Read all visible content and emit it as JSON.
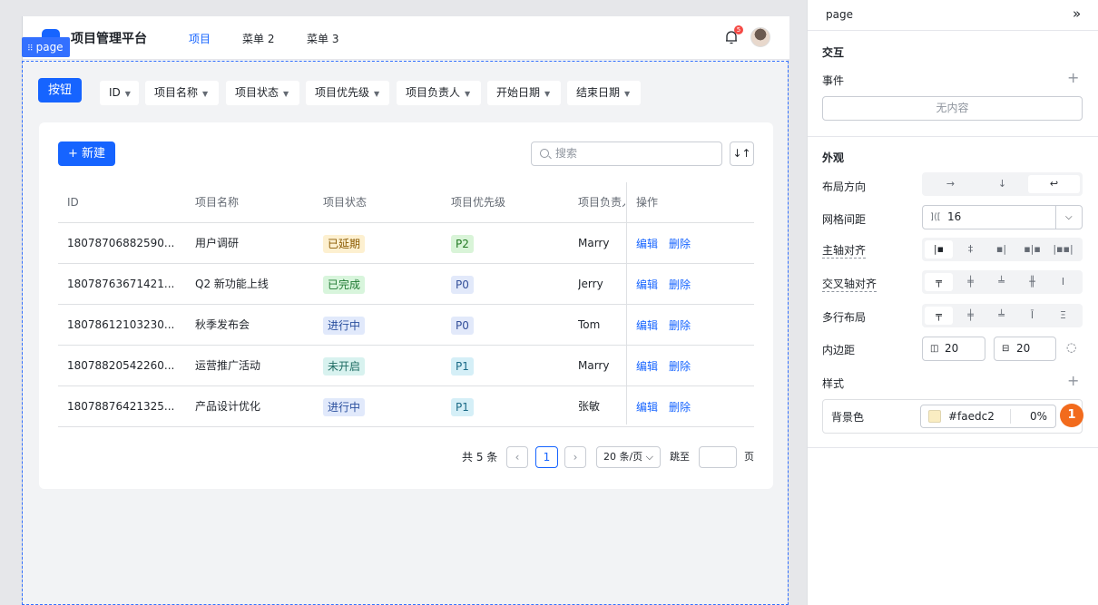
{
  "header": {
    "brand": "项目管理平台",
    "nav": [
      "项目",
      "菜单 2",
      "菜单 3"
    ],
    "bell_badge": "5"
  },
  "page_tag": "page",
  "toolbar": {
    "button_label": "按钮",
    "filters": [
      "ID",
      "项目名称",
      "项目状态",
      "项目优先级",
      "项目负责人",
      "开始日期",
      "结束日期"
    ]
  },
  "card": {
    "new_label": "+ 新建",
    "search_placeholder": "搜索",
    "sort_icon": "↓↑",
    "columns": [
      "ID",
      "项目名称",
      "项目状态",
      "项目优先级",
      "项目负责人",
      "操作"
    ],
    "rows": [
      {
        "id": "18078706882590...",
        "name": "用户调研",
        "status": "已延期",
        "priority": "P2",
        "owner": "Marry"
      },
      {
        "id": "18078763671421...",
        "name": "Q2 新功能上线",
        "status": "已完成",
        "priority": "P0",
        "owner": "Jerry"
      },
      {
        "id": "18078612103230...",
        "name": "秋季发布会",
        "status": "进行中",
        "priority": "P0",
        "owner": "Tom"
      },
      {
        "id": "18078820542260...",
        "name": "运营推广活动",
        "status": "未开启",
        "priority": "P1",
        "owner": "Marry"
      },
      {
        "id": "18078876421325...",
        "name": "产品设计优化",
        "status": "进行中",
        "priority": "P1",
        "owner": "张敏"
      }
    ],
    "actions": {
      "edit": "编辑",
      "delete": "删除"
    },
    "pager": {
      "total": "共 5 条",
      "current": "1",
      "page_size": "20 条/页",
      "jump": "跳至",
      "page_unit": "页"
    }
  },
  "status_colors": {
    "已延期": {
      "bg": "#fdf0d0",
      "fg": "#8a5a00"
    },
    "已完成": {
      "bg": "#d8f5dc",
      "fg": "#1f7a32"
    },
    "进行中": {
      "bg": "#e1e9fb",
      "fg": "#2a4f9e"
    },
    "未开启": {
      "bg": "#d8f2ef",
      "fg": "#1d6b62"
    }
  },
  "priority_colors": {
    "P2": {
      "bg": "#d9f4d8",
      "fg": "#237a22"
    },
    "P0": {
      "bg": "#e2e9fa",
      "fg": "#34509a"
    },
    "P1": {
      "bg": "#d5eff7",
      "fg": "#1b6a86"
    }
  },
  "panel": {
    "title": "page",
    "collapse_icon": "»",
    "interaction": {
      "title": "交互",
      "events_label": "事件",
      "empty": "无内容"
    },
    "appearance": {
      "title": "外观",
      "layout_direction": "布局方向",
      "grid_gap": "网格间距",
      "grid_gap_value": "16",
      "main_axis": "主轴对齐",
      "cross_axis": "交叉轴对齐",
      "multi_line": "多行布局",
      "padding": "内边距",
      "padding_x": "20",
      "padding_y": "20",
      "style_label": "样式",
      "bg_label": "背景色",
      "bg_value": "#faedc2",
      "bg_opacity": "0%",
      "marker": "1"
    }
  },
  "colors": {
    "accent": "#1664ff",
    "marker": "#f26b1d"
  }
}
